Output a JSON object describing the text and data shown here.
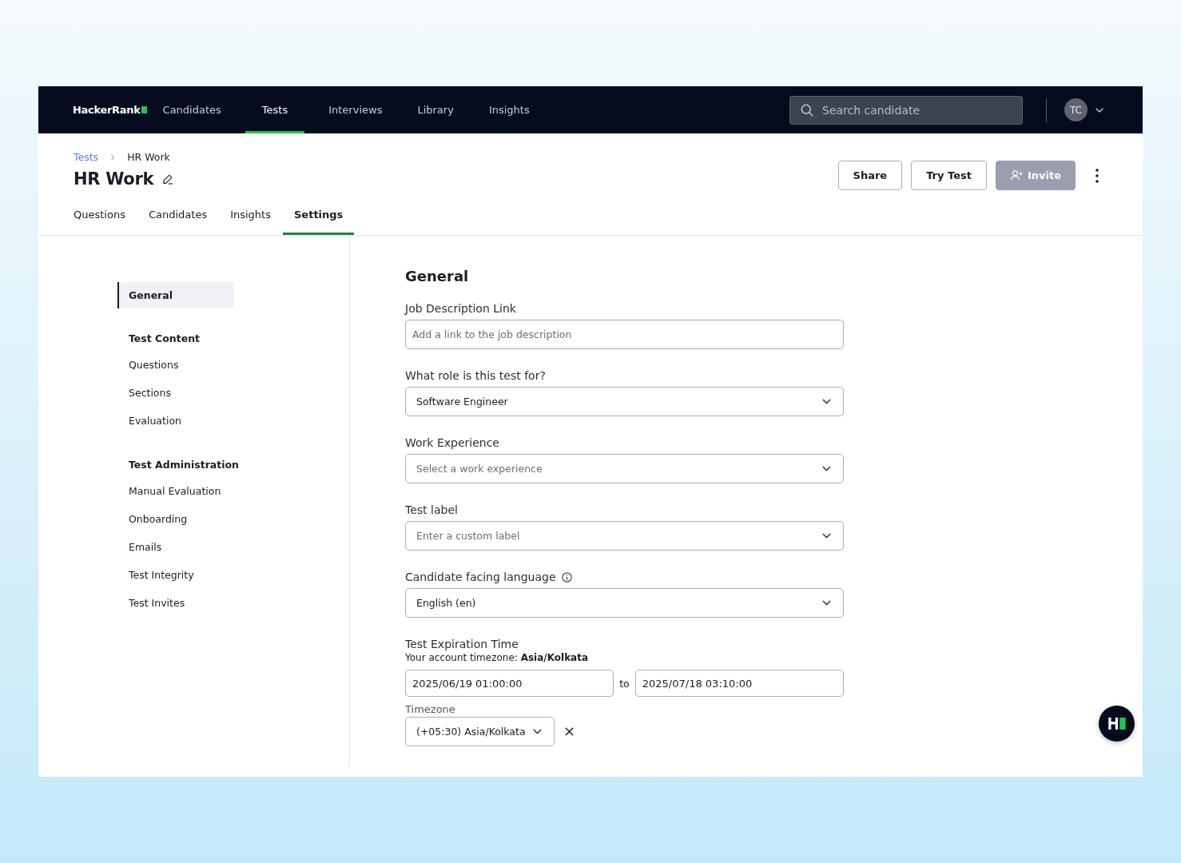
{
  "nav": {
    "logo": "HackerRank",
    "items": [
      {
        "label": "Candidates",
        "selected": false
      },
      {
        "label": "Tests",
        "selected": true
      },
      {
        "label": "Interviews",
        "selected": false
      },
      {
        "label": "Library",
        "selected": false
      },
      {
        "label": "Insights",
        "selected": false
      }
    ],
    "search": {
      "placeholder": "Search candidate"
    },
    "avatar": "TC"
  },
  "breadcrumb": [
    "Tests",
    "HR Work"
  ],
  "title": "HR Work",
  "actions": [
    {
      "label": "Share",
      "disabled": false
    },
    {
      "label": "Try Test",
      "disabled": false
    },
    {
      "label": "Invite",
      "disabled": true
    }
  ],
  "tabs": [
    {
      "label": "Questions",
      "selected": false
    },
    {
      "label": "Candidates",
      "selected": false
    },
    {
      "label": "Insights",
      "selected": false
    },
    {
      "label": "Settings",
      "selected": true
    }
  ],
  "sidebar": {
    "items": [
      {
        "kind": "item",
        "label": "General",
        "selected": true
      },
      {
        "kind": "heading",
        "label": "Test Content"
      },
      {
        "kind": "item",
        "label": "Questions",
        "selected": false
      },
      {
        "kind": "item",
        "label": "Sections",
        "selected": false
      },
      {
        "kind": "item",
        "label": "Evaluation",
        "selected": false
      },
      {
        "kind": "heading",
        "label": "Test Administration"
      },
      {
        "kind": "item",
        "label": "Manual Evaluation",
        "selected": false
      },
      {
        "kind": "item",
        "label": "Onboarding",
        "selected": false
      },
      {
        "kind": "item",
        "label": "Emails",
        "selected": false
      },
      {
        "kind": "item",
        "label": "Test Integrity",
        "selected": false
      },
      {
        "kind": "item",
        "label": "Test Invites",
        "selected": false
      }
    ]
  },
  "form": {
    "title": "General",
    "fields": [
      {
        "kind": "text",
        "label": "Job Description Link",
        "placeholder": "Add a link to the job description"
      },
      {
        "kind": "select",
        "label": "What role is this test for?",
        "value": "Software Engineer"
      },
      {
        "kind": "select",
        "label": "Work Experience",
        "placeholder": "Select a work experience"
      },
      {
        "kind": "select",
        "label": "Test label",
        "placeholder": "Enter a custom label"
      },
      {
        "kind": "select",
        "label": "Candidate facing language",
        "info": true,
        "value": "English (en)"
      }
    ],
    "expiration": {
      "label": "Test Expiration Time",
      "note": "Your account timezone: **Asia/Kolkata**",
      "start": "2025/06/19 01:00:00",
      "separator": "to",
      "end": "2025/07/18 03:10:00",
      "timezone_label": "Timezone",
      "timezone": "(+05:30) Asia/Kolkata"
    }
  }
}
